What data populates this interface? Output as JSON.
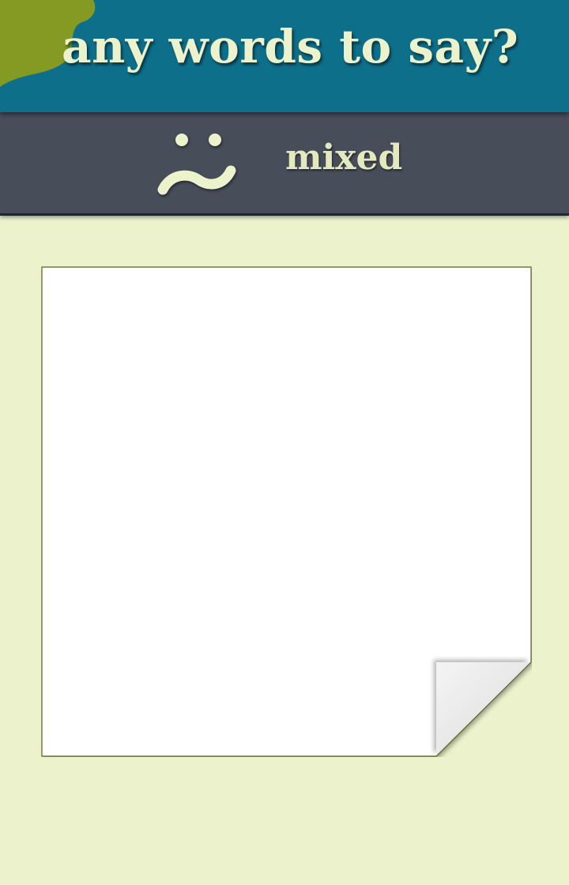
{
  "header": {
    "title": "any words to say?"
  },
  "mood": {
    "icon": "mixed-face-icon",
    "label": "mixed"
  },
  "note": {
    "value": "",
    "placeholder": ""
  },
  "colors": {
    "background": "#ecf2cc",
    "header": "#0e6f8a",
    "accent_blob": "#849a22",
    "mood_bar": "#474d59",
    "text_light": "#ecf2cc",
    "paper": "#ffffff",
    "page_curl": "#e8e8e8"
  }
}
